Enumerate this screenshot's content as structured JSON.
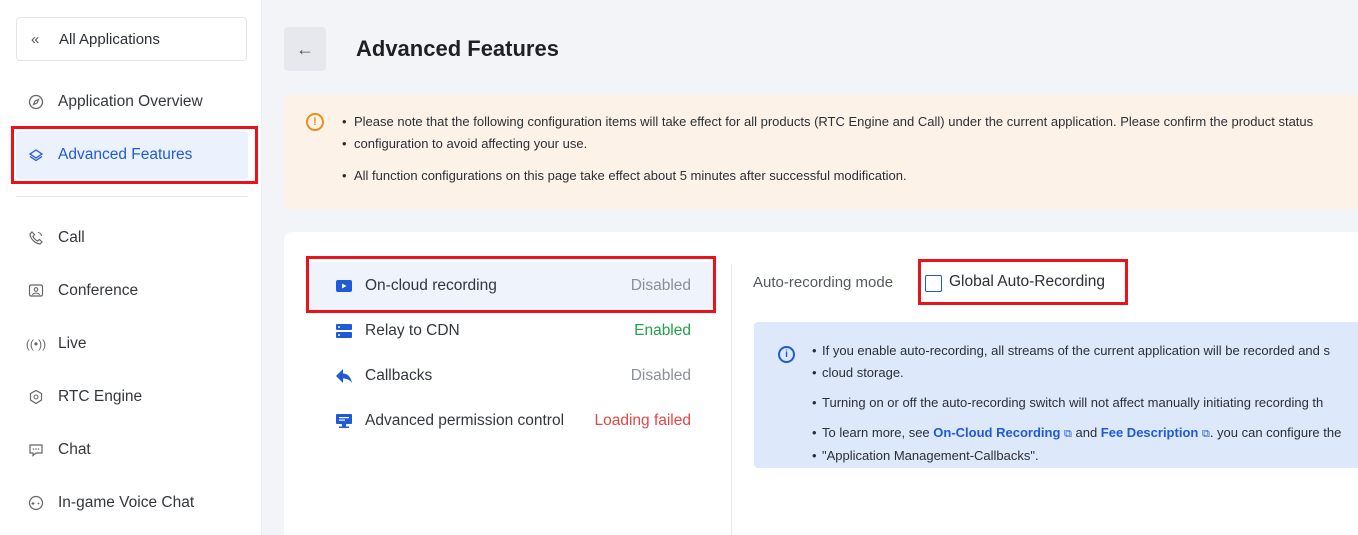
{
  "sidebar": {
    "all_apps": "All Applications",
    "items": [
      {
        "label": "Application Overview",
        "icon": "compass-icon"
      },
      {
        "label": "Advanced Features",
        "icon": "layers-icon"
      },
      {
        "label": "Call",
        "icon": "phone-icon"
      },
      {
        "label": "Conference",
        "icon": "conference-icon"
      },
      {
        "label": "Live",
        "icon": "broadcast-icon"
      },
      {
        "label": "RTC Engine",
        "icon": "engine-icon"
      },
      {
        "label": "Chat",
        "icon": "chat-icon"
      },
      {
        "label": "In-game Voice Chat",
        "icon": "gamepad-icon"
      }
    ]
  },
  "header": {
    "title": "Advanced Features"
  },
  "notice": {
    "line1": "Please note that the following configuration items will take effect for all products (RTC Engine and Call) under the current application. Please confirm the product status",
    "line1b": "configuration to avoid affecting your use.",
    "line2": "All function configurations on this page take effect about 5 minutes after successful modification."
  },
  "features": [
    {
      "label": "On-cloud recording",
      "status": "Disabled",
      "icon": "video-icon"
    },
    {
      "label": "Relay to CDN",
      "status": "Enabled",
      "icon": "server-icon"
    },
    {
      "label": "Callbacks",
      "status": "Disabled",
      "icon": "reply-icon"
    },
    {
      "label": "Advanced permission control",
      "status": "Loading failed",
      "icon": "monitor-icon"
    }
  ],
  "recording": {
    "mode_label": "Auto-recording mode",
    "checkbox_label": "Global Auto-Recording",
    "checked": false,
    "info": {
      "line1": "If you enable auto-recording, all streams of the current application will be recorded and s",
      "line1b": "cloud storage.",
      "line2": "Turning on or off the auto-recording switch will not affect manually initiating recording th",
      "line3_pre": "To learn more, see ",
      "link1": "On-Cloud Recording",
      "line3_mid": " and ",
      "link2": "Fee Description",
      "line3_post": ". you can configure the",
      "line3b": "\"Application Management-Callbacks\"."
    }
  },
  "colors": {
    "accent": "#1f5bd8",
    "enabled": "#1fa34a",
    "failed": "#e54545",
    "highlight_box": "#e8131b"
  }
}
